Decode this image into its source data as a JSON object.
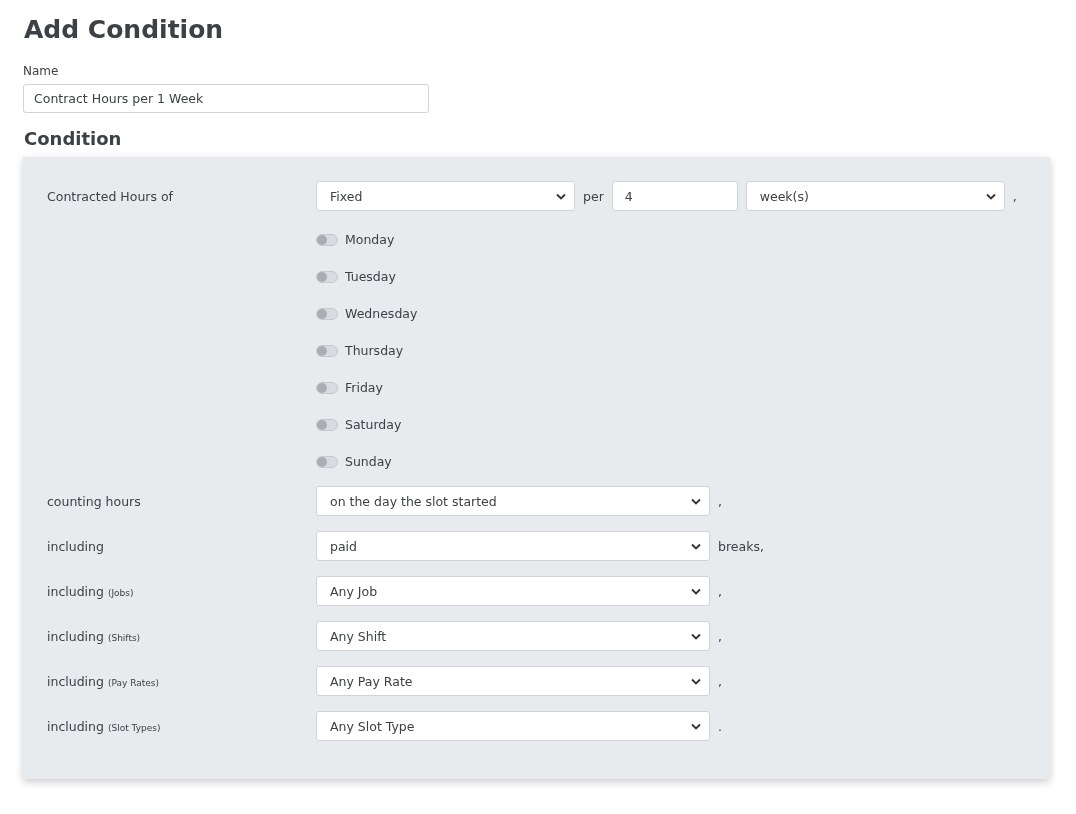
{
  "page_title": "Add Condition",
  "name_field": {
    "label": "Name",
    "value": "Contract Hours per 1 Week"
  },
  "section_title": "Condition",
  "contracted": {
    "label": "Contracted Hours of",
    "type_select": "Fixed",
    "per_label": "per",
    "period_value": "4",
    "unit_select": "week(s)",
    "suffix": ","
  },
  "days": [
    {
      "label": "Monday",
      "on": false
    },
    {
      "label": "Tuesday",
      "on": false
    },
    {
      "label": "Wednesday",
      "on": false
    },
    {
      "label": "Thursday",
      "on": false
    },
    {
      "label": "Friday",
      "on": false
    },
    {
      "label": "Saturday",
      "on": false
    },
    {
      "label": "Sunday",
      "on": false
    }
  ],
  "rows": [
    {
      "label": "counting hours",
      "value": "on the day the slot started",
      "suffix": ","
    },
    {
      "label": "including",
      "value": "paid",
      "suffix": "breaks,"
    },
    {
      "label": "including",
      "note": "(Jobs)",
      "value": "Any Job",
      "suffix": ","
    },
    {
      "label": "including",
      "note": "(Shifts)",
      "value": "Any Shift",
      "suffix": ","
    },
    {
      "label": "including",
      "note": "(Pay Rates)",
      "value": "Any Pay Rate",
      "suffix": ","
    },
    {
      "label": "including",
      "note": "(Slot Types)",
      "value": "Any Slot Type",
      "suffix": "."
    }
  ]
}
